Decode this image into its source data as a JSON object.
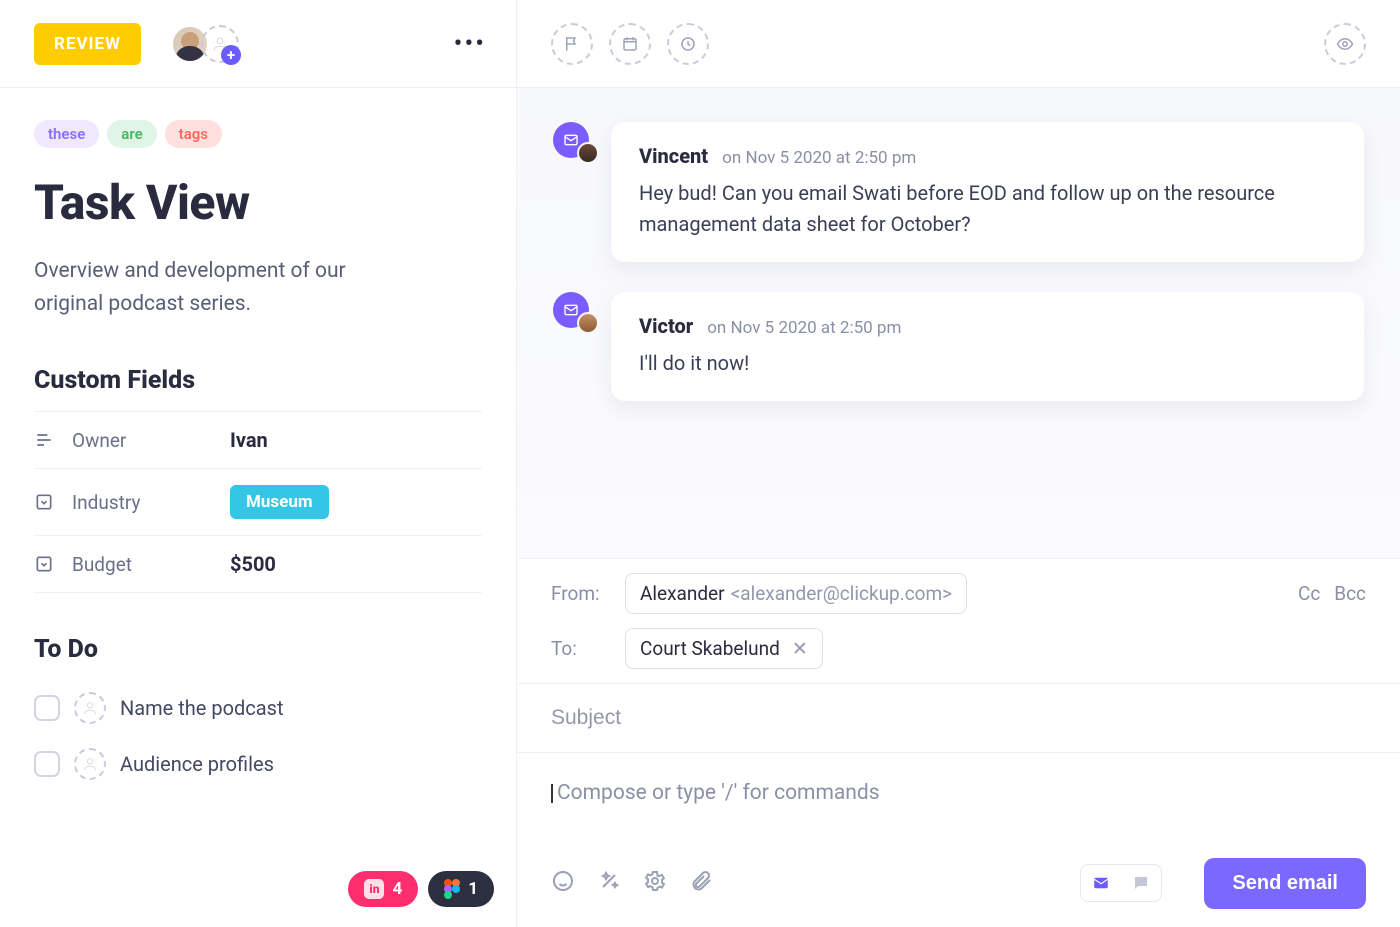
{
  "header": {
    "status_label": "REVIEW"
  },
  "tags": [
    "these",
    "are",
    "tags"
  ],
  "task": {
    "title": "Task View",
    "description": "Overview and development of our original podcast series."
  },
  "custom_fields": {
    "heading": "Custom Fields",
    "rows": [
      {
        "label": "Owner",
        "value": "Ivan",
        "kind": "text"
      },
      {
        "label": "Industry",
        "value": "Museum",
        "kind": "chip"
      },
      {
        "label": "Budget",
        "value": "$500",
        "kind": "text"
      }
    ]
  },
  "todo": {
    "heading": "To Do",
    "items": [
      {
        "label": "Name the podcast"
      },
      {
        "label": "Audience profiles"
      }
    ]
  },
  "attachments": {
    "invision_count": "4",
    "figma_count": "1"
  },
  "thread": [
    {
      "author": "Vincent",
      "timestamp": "on Nov 5 2020 at 2:50 pm",
      "body": "Hey bud! Can you email Swati before EOD and follow up on the resource management data sheet for October?"
    },
    {
      "author": "Victor",
      "timestamp": "on Nov 5 2020 at 2:50 pm",
      "body": "I'll do it now!"
    }
  ],
  "composer": {
    "from_label": "From:",
    "to_label": "To:",
    "from_name": "Alexander",
    "from_email": "<alexander@clickup.com>",
    "to_name": "Court Skabelund",
    "cc_label": "Cc",
    "bcc_label": "Bcc",
    "subject_placeholder": "Subject",
    "body_placeholder": "Compose or type '/' for commands",
    "send_label": "Send email"
  }
}
